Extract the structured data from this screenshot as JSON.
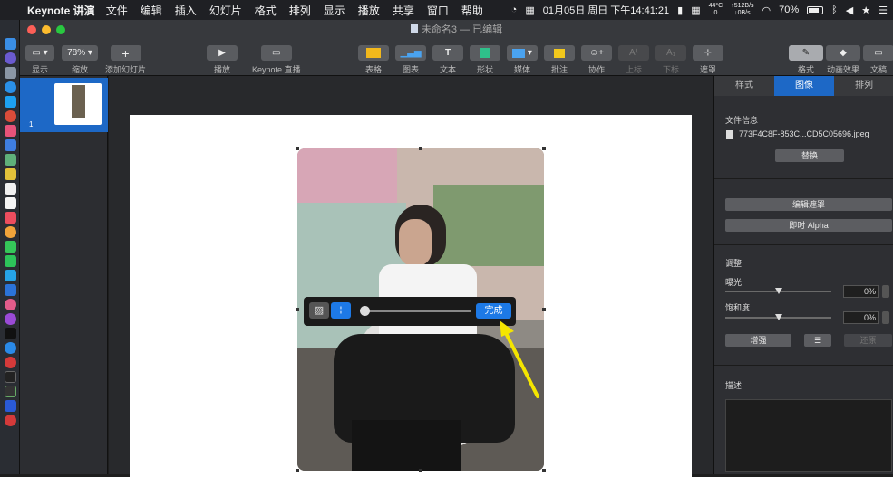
{
  "menubar": {
    "app_name": "Keynote 讲演",
    "items": [
      "文件",
      "编辑",
      "插入",
      "幻灯片",
      "格式",
      "排列",
      "显示",
      "播放",
      "共享",
      "窗口",
      "帮助"
    ],
    "datetime": "01月05日 周日 下午14:41:21",
    "cpu_temp_top": "44°C",
    "cpu_temp_bottom": "0",
    "net_up": "↑512B/s",
    "net_down": "↓0B/s",
    "battery": "70%"
  },
  "window": {
    "title": "未命名3 — 已编辑"
  },
  "toolbar": {
    "view_label": "显示",
    "zoom_value": "78%",
    "zoom_label": "缩放",
    "add_slide_label": "添加幻灯片",
    "play_label": "播放",
    "keynote_live_label": "Keynote 直播",
    "table_label": "表格",
    "chart_label": "图表",
    "text_label": "文本",
    "shape_label": "形状",
    "media_label": "媒体",
    "comment_label": "批注",
    "collaborate_label": "协作",
    "superscript_label": "上标",
    "subscript_label": "下标",
    "mask_label": "遮罩",
    "format_label": "格式",
    "animate_label": "动画效果",
    "document_label": "文稿"
  },
  "slide_nav": {
    "slide_number": "1"
  },
  "mask_bar": {
    "done_label": "完成"
  },
  "inspector": {
    "tabs": [
      "样式",
      "图像",
      "排列"
    ],
    "file_info_title": "文件信息",
    "file_name": "773F4C8F-853C...CD5C05696.jpeg",
    "replace_label": "替换",
    "edit_mask_label": "编辑遮罩",
    "instant_alpha_label": "即时 Alpha",
    "adjust_title": "调整",
    "exposure_label": "曝光",
    "exposure_value": "0%",
    "saturation_label": "饱和度",
    "saturation_value": "0%",
    "enhance_label": "增强",
    "reset_label": "还原",
    "description_title": "描述"
  }
}
